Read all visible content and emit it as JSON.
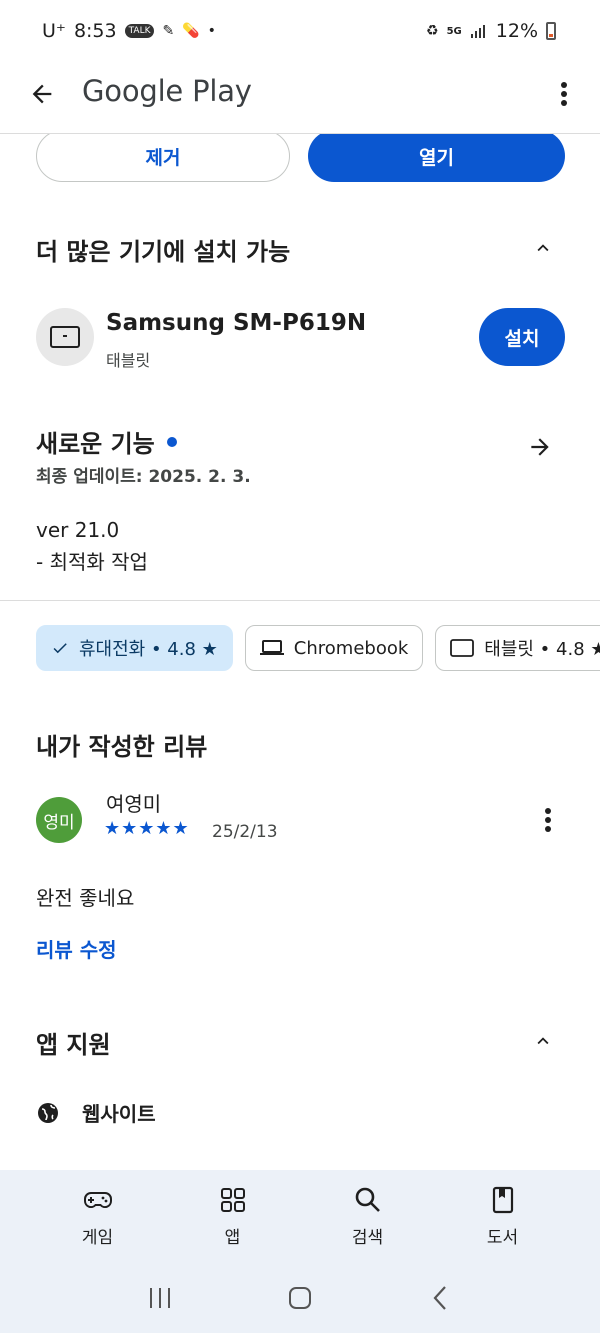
{
  "status_bar": {
    "carrier": "U⁺",
    "time": "8:53",
    "talk_badge": "TALK",
    "network": "5G",
    "battery": "12%"
  },
  "app_bar": {
    "title": "Google Play"
  },
  "actions": {
    "uninstall_label": "제거",
    "open_label": "열기"
  },
  "more_devices": {
    "title": "더 많은 기기에 설치 가능",
    "device_name": "Samsung SM-P619N",
    "device_type": "태블릿",
    "install_label": "설치"
  },
  "whats_new": {
    "title": "새로운 기능",
    "updated": "최종 업데이트: 2025. 2. 3.",
    "version": "ver 21.0",
    "notes": "- 최적화 작업"
  },
  "device_chips": [
    {
      "label": "휴대전화 • 4.8 ★",
      "selected": true,
      "icon": "check-icon"
    },
    {
      "label": "Chromebook",
      "selected": false,
      "icon": "laptop-icon"
    },
    {
      "label": "태블릿 • 4.8 ★",
      "selected": false,
      "icon": "tablet-icon"
    }
  ],
  "my_review": {
    "title": "내가 작성한 리뷰",
    "avatar_initials": "영미",
    "reviewer": "여영미",
    "rating": 5,
    "stars": "★★★★★",
    "date": "25/2/13",
    "text": "완전 좋네요",
    "edit_label": "리뷰 수정"
  },
  "app_support": {
    "title": "앱 지원",
    "website_label": "웹사이트"
  },
  "bottom_nav": {
    "games": "게임",
    "apps": "앱",
    "search": "검색",
    "books": "도서"
  },
  "colors": {
    "accent": "#0b57d0",
    "chip_selected": "#d3e9fb",
    "avatar": "#4f9d3a",
    "nav_bg": "#ecf1f8"
  }
}
